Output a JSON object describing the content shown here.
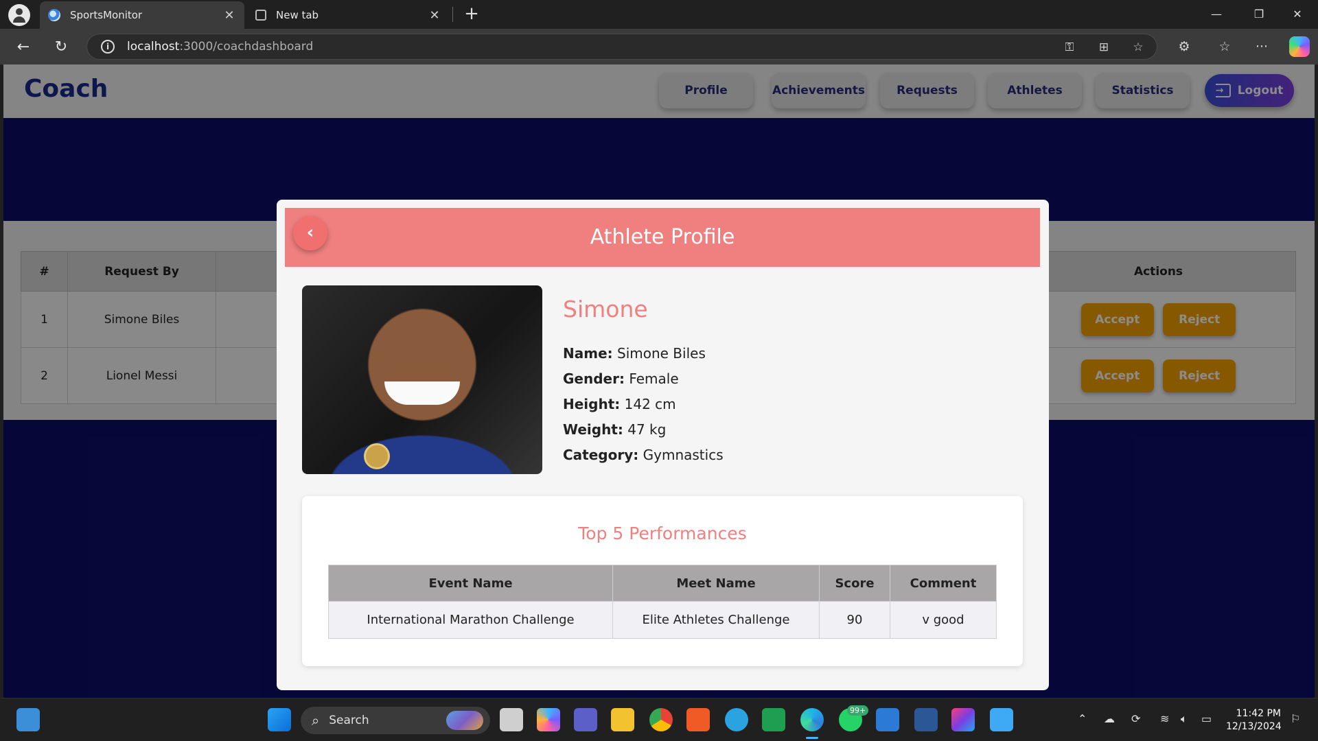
{
  "browser": {
    "tabs": [
      {
        "label": "SportsMonitor",
        "active": true
      },
      {
        "label": "New tab",
        "active": false
      }
    ],
    "url_host": "localhost",
    "url_path": ":3000/coachdashboard"
  },
  "app": {
    "brand": "Coach",
    "nav": [
      "Profile",
      "Achievements",
      "Requests",
      "Athletes",
      "Statistics"
    ],
    "logout_label": "Logout"
  },
  "requests_table": {
    "headers": [
      "#",
      "Request By",
      "Actions"
    ],
    "rows": [
      {
        "index": "1",
        "name": "Simone Biles"
      },
      {
        "index": "2",
        "name": "Lionel Messi"
      }
    ],
    "accept_label": "Accept",
    "reject_label": "Reject"
  },
  "modal": {
    "title": "Athlete Profile",
    "display_name": "Simone",
    "fields": [
      {
        "label": "Name:",
        "value": "Simone Biles"
      },
      {
        "label": "Gender:",
        "value": "Female"
      },
      {
        "label": "Height:",
        "value": "142 cm"
      },
      {
        "label": "Weight:",
        "value": "47 kg"
      },
      {
        "label": "Category:",
        "value": "Gymnastics"
      }
    ],
    "performances_title": "Top 5 Performances",
    "performance_headers": [
      "Event Name",
      "Meet Name",
      "Score",
      "Comment"
    ],
    "performances": [
      {
        "event": "International Marathon Challenge",
        "meet": "Elite Athletes Challenge",
        "score": "90",
        "comment": "v good"
      }
    ]
  },
  "taskbar": {
    "search_label": "Search",
    "notification_badge": "99+",
    "time": "11:42 PM",
    "date": "12/13/2024"
  },
  "colors": {
    "accent_salmon": "#f08080",
    "brand_navy": "#1a2a8a",
    "page_bg": "#0c0c68",
    "action_orange": "#f5a300"
  }
}
